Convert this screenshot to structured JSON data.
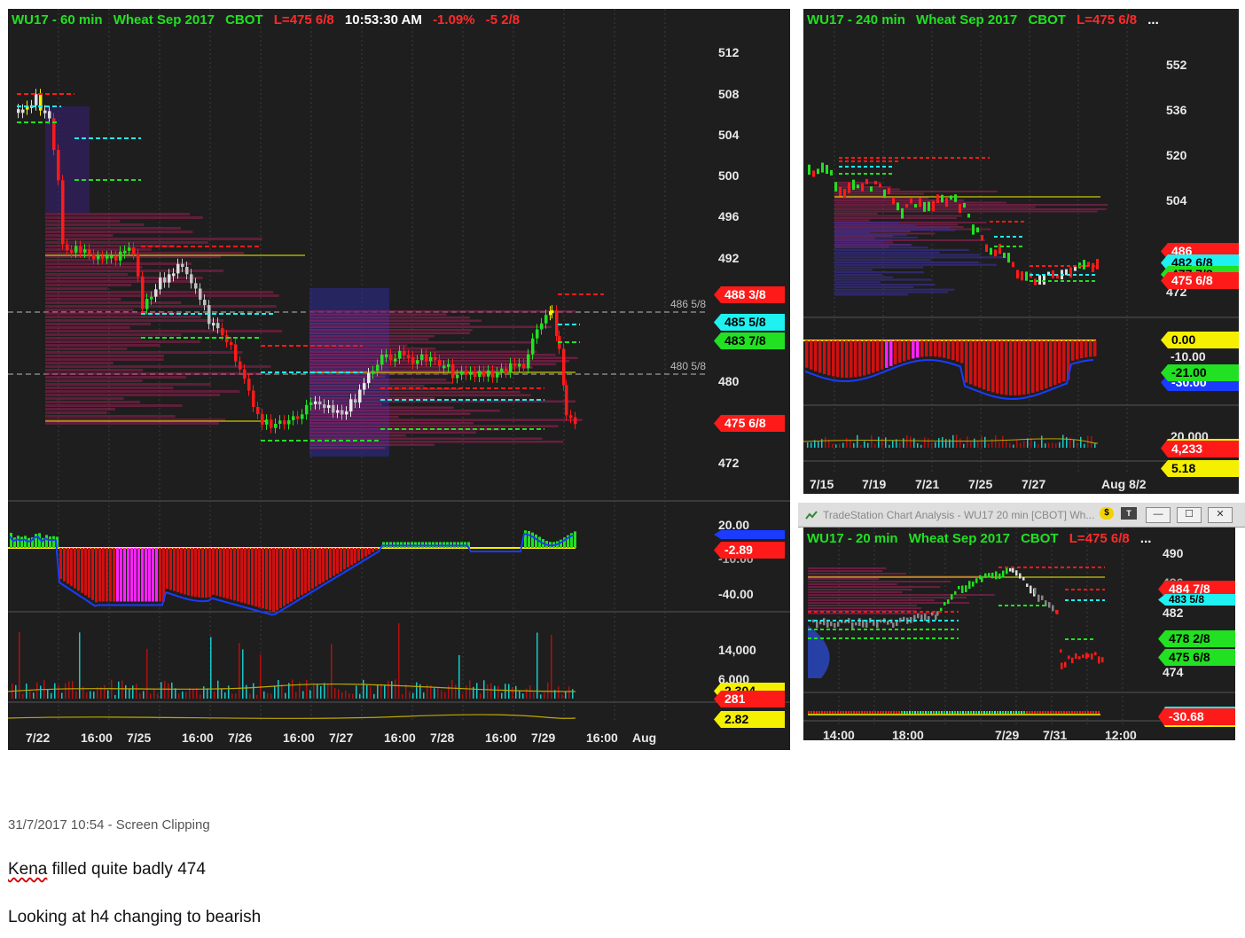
{
  "main_chart": {
    "title": {
      "symbol_interval": "WU17 - 60 min",
      "instrument": "Wheat Sep 2017",
      "exchange": "CBOT",
      "last": "L=475 6/8",
      "time": "10:53:30 AM",
      "pct_change": "-1.09%",
      "change": "-5 2/8"
    },
    "price_axis": [
      "512",
      "508",
      "504",
      "500",
      "496",
      "492",
      "480",
      "472"
    ],
    "reference_lines": [
      "486 5/8",
      "480 5/8"
    ],
    "price_tags": [
      "488 3/8",
      "485 5/8",
      "483 7/8",
      "475 6/8"
    ],
    "oscillator_axis": [
      "20.00",
      "-40.00"
    ],
    "oscillator_tag": "-2.89",
    "oscillator_hidden_label": "-10.00",
    "volume_axis": [
      "14,000",
      "6,000"
    ],
    "volume_tags": [
      "2,304",
      "281",
      "2.82"
    ],
    "time_axis": [
      "7/22",
      "16:00",
      "7/25",
      "16:00",
      "7/26",
      "16:00",
      "7/27",
      "16:00",
      "7/28",
      "16:00",
      "7/29",
      "16:00",
      "Aug"
    ]
  },
  "chart_240": {
    "title": {
      "symbol_interval": "WU17 - 240 min",
      "instrument": "Wheat Sep 2017",
      "exchange": "CBOT",
      "last": "L=475 6/8",
      "ellipsis": "..."
    },
    "price_axis": [
      "552",
      "536",
      "520",
      "504",
      "472"
    ],
    "price_tags": [
      "486",
      "482 6/8",
      "477 7/8",
      "475 6/8"
    ],
    "oscillator_tags": [
      "0.00",
      "-10.00",
      "-21.00",
      "-30.00"
    ],
    "volume_tags": [
      "20,000",
      "4,233",
      "5.18"
    ],
    "time_axis": [
      "7/15",
      "7/19",
      "7/21",
      "7/25",
      "7/27",
      "Aug 8/2"
    ]
  },
  "window_20": {
    "window_title": "TradeStation Chart Analysis - WU17 20 min [CBOT] Wh...",
    "chrome_badges": [
      "$",
      "T"
    ],
    "controls": [
      "—",
      "☐",
      "✕"
    ],
    "title": {
      "symbol_interval": "WU17 - 20 min",
      "instrument": "Wheat Sep 2017",
      "exchange": "CBOT",
      "last": "L=475 6/8",
      "ellipsis": "..."
    },
    "price_axis": [
      "490",
      "486",
      "482",
      "474"
    ],
    "price_tags": [
      "484 7/8",
      "483 5/8",
      "478 2/8",
      "475 6/8"
    ],
    "oscillator_tag": "-30.68",
    "time_axis": [
      "14:00",
      "18:00",
      "7/29",
      "7/31",
      "12:00"
    ]
  },
  "notes": {
    "timestamp": "31/7/2017 10:54 - Screen Clipping",
    "line1_name": "Kena",
    "line1_rest": " filled quite badly 474",
    "line2": "Looking at h4 changing to bearish"
  },
  "colors": {
    "background": "#1e1e1e",
    "green": "#22e022",
    "red": "#ff1a1a",
    "cyan": "#1ff0f0",
    "yellow": "#f5f000",
    "magenta": "#ff22ff",
    "blue": "#1b3cff"
  }
}
